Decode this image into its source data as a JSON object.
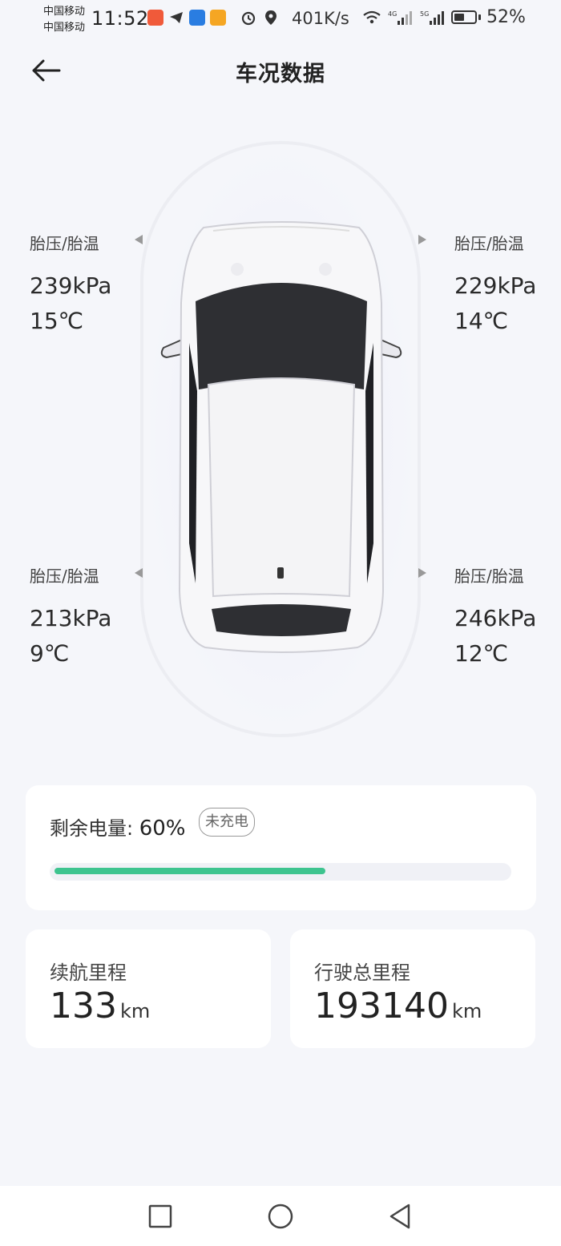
{
  "status_bar": {
    "carrier1": "中国移动",
    "carrier2": "中国移动",
    "time": "11:52",
    "net_speed": "401K/s",
    "net_4g": "4G",
    "net_5g": "5G",
    "battery_pct": "52%",
    "battery_level": 0.52
  },
  "header": {
    "title": "车况数据"
  },
  "tires": {
    "front_left": {
      "label": "胎压/胎温",
      "pressure": "239kPa",
      "temp": "15℃"
    },
    "front_right": {
      "label": "胎压/胎温",
      "pressure": "229kPa",
      "temp": "14℃"
    },
    "rear_left": {
      "label": "胎压/胎温",
      "pressure": "213kPa",
      "temp": "9℃"
    },
    "rear_right": {
      "label": "胎压/胎温",
      "pressure": "246kPa",
      "temp": "12℃"
    }
  },
  "battery": {
    "label": "剩余电量: ",
    "value": "60%",
    "level": 0.6,
    "status": "未充电",
    "bar_color": "#3ec48f"
  },
  "range": {
    "label": "续航里程",
    "value": "133",
    "unit": "km"
  },
  "odometer": {
    "label": "行驶总里程",
    "value": "193140",
    "unit": "km"
  },
  "nav": {
    "square_icon": "recent-apps-icon",
    "circle_icon": "home-icon",
    "triangle_icon": "back-icon"
  }
}
